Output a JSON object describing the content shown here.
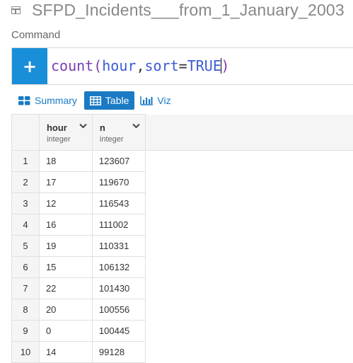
{
  "dataset": {
    "title": "SFPD_Incidents___from_1_January_2003",
    "icon": "table-icon"
  },
  "command": {
    "label": "Command",
    "fn": "count",
    "open_paren": "(",
    "arg1": "hour",
    "comma": ",",
    "arg2_name": "sort",
    "equals": "=",
    "arg2_value": "TRUE",
    "close_paren": ")"
  },
  "tabs": [
    {
      "label": "Summary",
      "icon": "summary-icon",
      "active": false
    },
    {
      "label": "Table",
      "icon": "table-icon",
      "active": true
    },
    {
      "label": "Viz",
      "icon": "bar-chart-icon",
      "active": false
    }
  ],
  "table": {
    "columns": [
      {
        "name": "hour",
        "type": "integer"
      },
      {
        "name": "n",
        "type": "integer"
      }
    ],
    "rows": [
      {
        "index": "1",
        "hour": "18",
        "n": "123607"
      },
      {
        "index": "2",
        "hour": "17",
        "n": "119670"
      },
      {
        "index": "3",
        "hour": "12",
        "n": "116543"
      },
      {
        "index": "4",
        "hour": "16",
        "n": "111002"
      },
      {
        "index": "5",
        "hour": "19",
        "n": "110331"
      },
      {
        "index": "6",
        "hour": "15",
        "n": "106132"
      },
      {
        "index": "7",
        "hour": "22",
        "n": "101430"
      },
      {
        "index": "8",
        "hour": "20",
        "n": "100556"
      },
      {
        "index": "9",
        "hour": "0",
        "n": "100445"
      },
      {
        "index": "10",
        "hour": "14",
        "n": "99128"
      }
    ]
  },
  "colors": {
    "accent": "#1a7ac4",
    "plus_button": "#1a8fd9"
  }
}
